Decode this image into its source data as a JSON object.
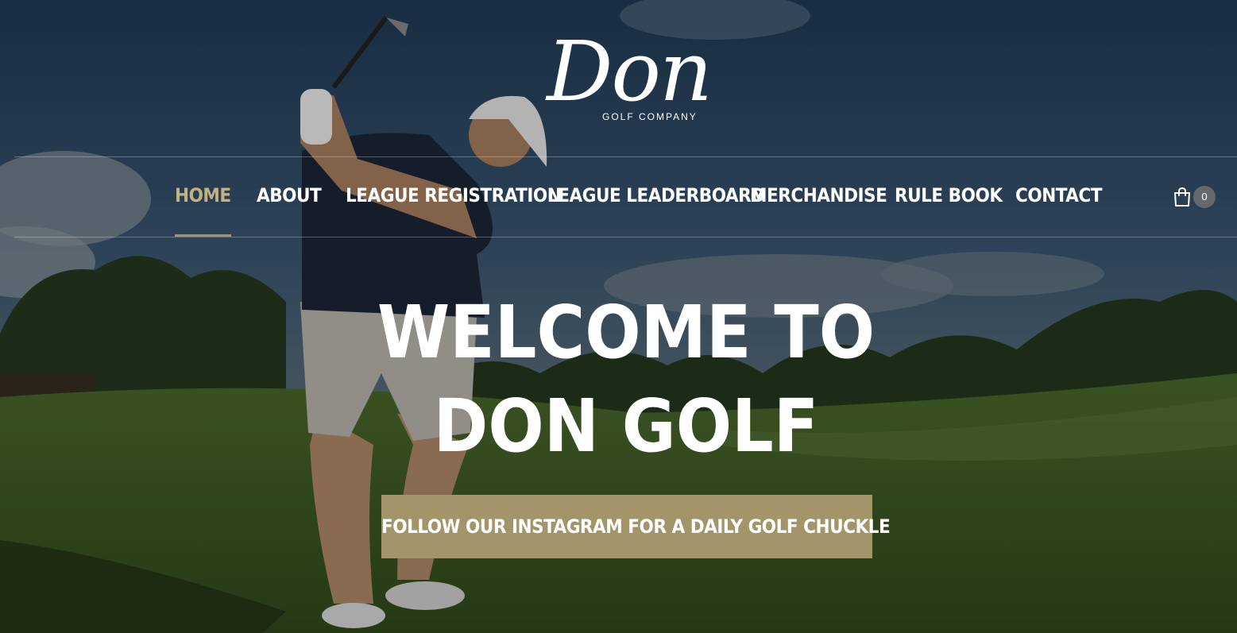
{
  "brand": {
    "logo_script": "Don",
    "logo_subtitle": "GOLF COMPANY"
  },
  "nav": {
    "items": [
      {
        "label": "HOME",
        "active": true
      },
      {
        "label": "ABOUT",
        "active": false
      },
      {
        "label": "LEAGUE REGISTRATION",
        "active": false
      },
      {
        "label": "LEAGUE LEADERBOARD",
        "active": false
      },
      {
        "label": "MERCHANDISE",
        "active": false
      },
      {
        "label": "RULE BOOK",
        "active": false
      },
      {
        "label": "CONTACT",
        "active": false
      }
    ]
  },
  "cart": {
    "icon": "shopping-bag-icon",
    "count": "0"
  },
  "hero": {
    "headline_line1": "WELCOME TO",
    "headline_line2": "DON GOLF",
    "cta_label": "FOLLOW OUR INSTAGRAM FOR A DAILY GOLF CHUCKLE",
    "background": "golfer-swinging-on-course-photo"
  },
  "colors": {
    "accent": "#a39569",
    "active_nav": "#c2b183",
    "text": "#ffffff"
  }
}
